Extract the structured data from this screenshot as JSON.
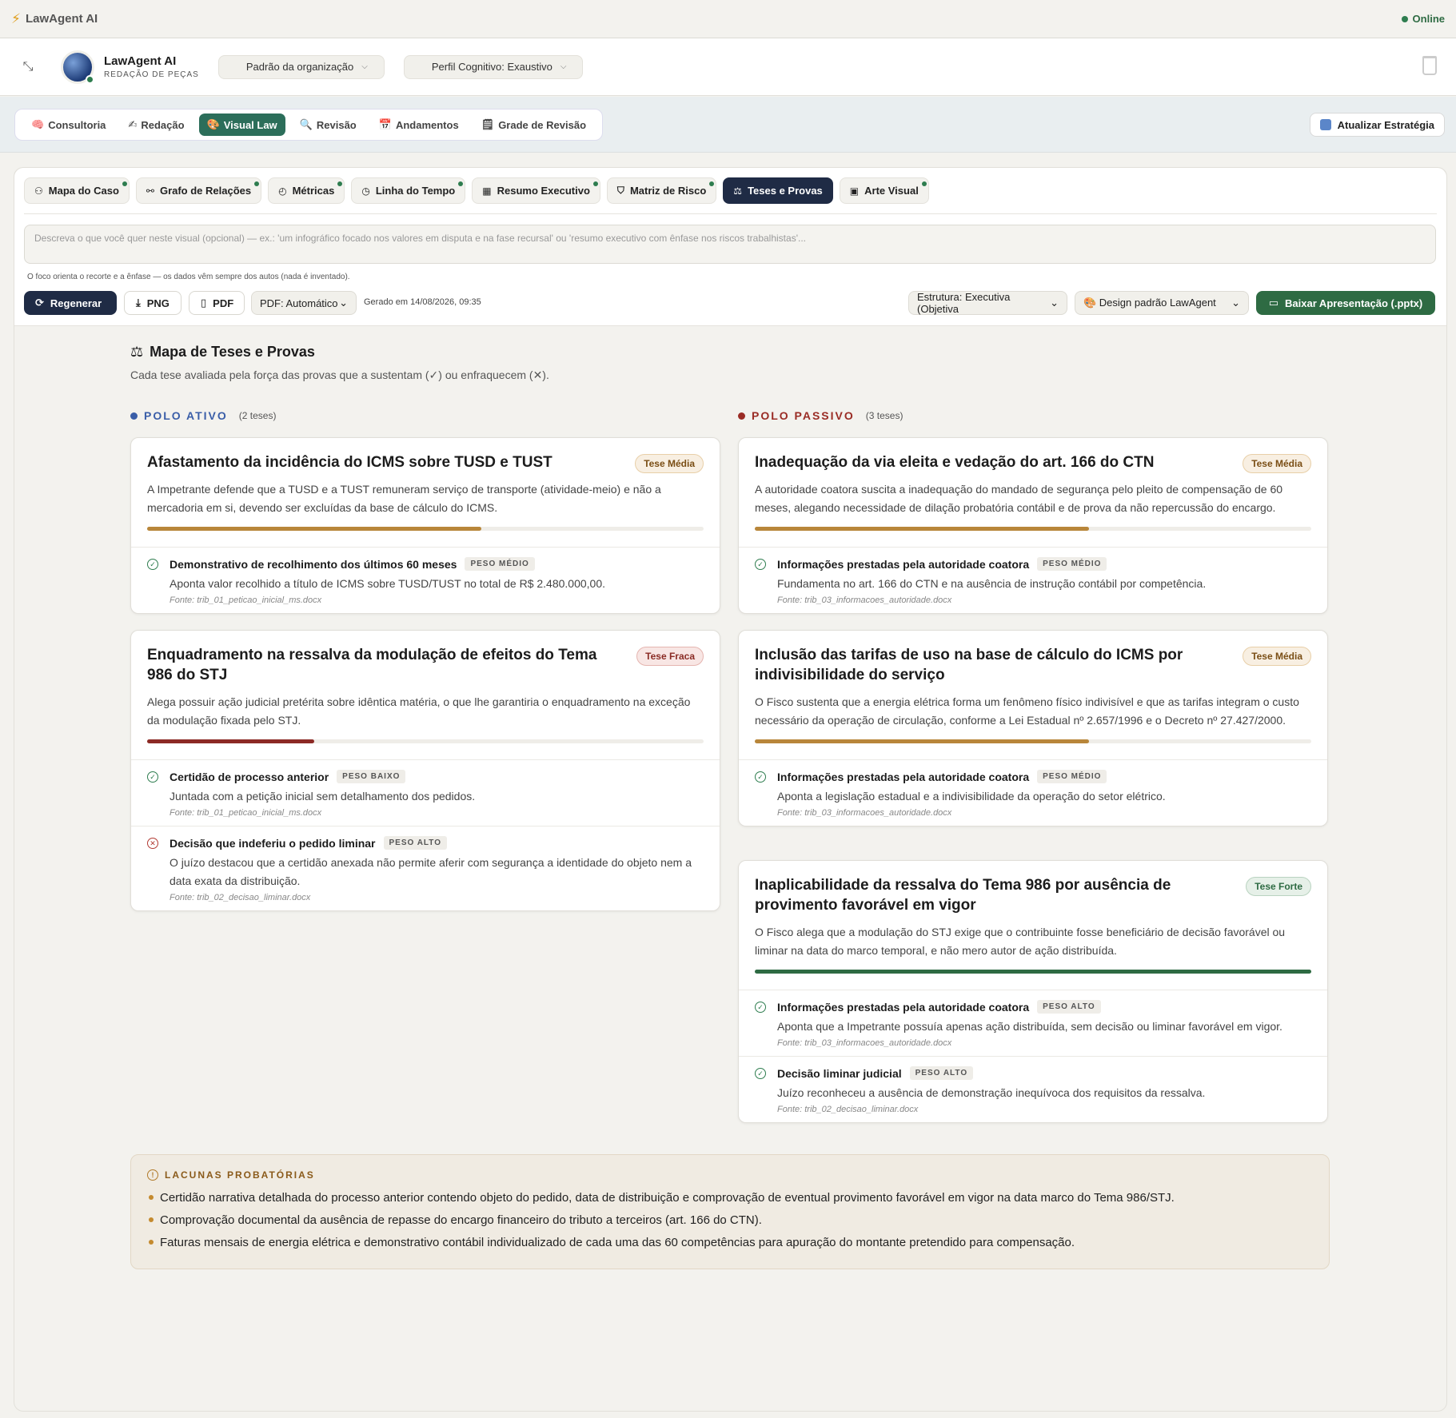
{
  "topbar": {
    "brand": "LawAgent AI",
    "status": "Online"
  },
  "header": {
    "app_name": "LawAgent AI",
    "app_subtitle": "REDAÇÃO DE PEÇAS",
    "org_select": "Padrão da organização",
    "profile_select": "Perfil Cognitivo: Exaustivo"
  },
  "main_tabs": [
    {
      "icon": "🧠",
      "label": "Consultoria"
    },
    {
      "icon": "✍",
      "label": "Redação"
    },
    {
      "icon": "🎨",
      "label": "Visual Law"
    },
    {
      "icon": "🔍",
      "label": "Revisão"
    },
    {
      "icon": "📅",
      "label": "Andamentos"
    },
    {
      "icon": "🗒",
      "label": "Grade de Revisão"
    }
  ],
  "refresh_label": "Atualizar Estratégia",
  "sub_tabs": [
    {
      "icon": "⚇",
      "label": "Mapa do Caso"
    },
    {
      "icon": "⚯",
      "label": "Grafo de Relações"
    },
    {
      "icon": "◴",
      "label": "Métricas"
    },
    {
      "icon": "◷",
      "label": "Linha do Tempo"
    },
    {
      "icon": "▦",
      "label": "Resumo Executivo"
    },
    {
      "icon": "⛉",
      "label": "Matriz de Risco"
    },
    {
      "icon": "⚖",
      "label": "Teses e Provas"
    },
    {
      "icon": "▣",
      "label": "Arte Visual"
    }
  ],
  "prompt_placeholder": "Descreva o que você quer neste visual (opcional) — ex.: 'um infográfico focado nos valores em disputa e na fase recursal' ou 'resumo executivo com ênfase nos riscos trabalhistas'...",
  "hint": "O foco orienta o recorte e a ênfase — os dados vêm sempre dos autos (nada é inventado).",
  "actions": {
    "regenerate": "Regenerar",
    "png": "PNG",
    "pdf": "PDF",
    "pdf_mode": "PDF: Automático",
    "generated": "Gerado em 14/08/2026, 09:35",
    "structure": "Estrutura: Executiva (Objetiva",
    "design": "🎨 Design padrão LawAgent",
    "download": "Baixar Apresentação (.pptx)"
  },
  "map": {
    "title": "Mapa de Teses e Provas",
    "subtitle": "Cada tese avaliada pela força das provas que a sustentam (✓) ou enfraquecem (✕)."
  },
  "active": {
    "label": "POLO ATIVO",
    "count": "(2 teses)",
    "color": "#3a5ea8",
    "cards": [
      {
        "title": "Afastamento da incidência do ICMS sobre TUSD e TUST",
        "badge": "Tese Média",
        "desc": "A Impetrante defende que a TUSD e a TUST remuneram serviço de transporte (atividade-meio) e não a mercadoria em si, devendo ser excluídas da base de cálculo do ICMS.",
        "strength": 0.6,
        "evidence": [
          {
            "title": "Demonstrativo de recolhimento dos últimos 60 meses",
            "weight": "PESO MÉDIO",
            "desc": "Aponta valor recolhido a título de ICMS sobre TUSD/TUST no total de R$ 2.480.000,00.",
            "source": "Fonte: trib_01_peticao_inicial_ms.docx"
          }
        ]
      },
      {
        "title": "Enquadramento na ressalva da modulação de efeitos do Tema 986 do STJ",
        "badge": "Tese Fraca",
        "desc": "Alega possuir ação judicial pretérita sobre idêntica matéria, o que lhe garantiria o enquadramento na exceção da modulação fixada pelo STJ.",
        "strength": 0.3,
        "evidence": [
          {
            "title": "Certidão de processo anterior",
            "weight": "PESO BAIXO",
            "desc": "Juntada com a petição inicial sem detalhamento dos pedidos.",
            "source": "Fonte: trib_01_peticao_inicial_ms.docx"
          },
          {
            "title": "Decisão que indeferiu o pedido liminar",
            "weight": "PESO ALTO",
            "desc": "O juízo destacou que a certidão anexada não permite aferir com segurança a identidade do objeto nem a data exata da distribuição.",
            "source": "Fonte: trib_02_decisao_liminar.docx"
          }
        ]
      }
    ]
  },
  "passive": {
    "label": "POLO PASSIVO",
    "count": "(3 teses)",
    "color": "#9a2c25",
    "cards": [
      {
        "title": "Inadequação da via eleita e vedação do art. 166 do CTN",
        "badge": "Tese Média",
        "desc": "A autoridade coatora suscita a inadequação do mandado de segurança pelo pleito de compensação de 60 meses, alegando necessidade de dilação probatória contábil e de prova da não repercussão do encargo.",
        "strength": 0.6,
        "evidence": [
          {
            "title": "Informações prestadas pela autoridade coatora",
            "weight": "PESO MÉDIO",
            "desc": "Fundamenta no art. 166 do CTN e na ausência de instrução contábil por competência.",
            "source": "Fonte: trib_03_informacoes_autoridade.docx"
          }
        ]
      },
      {
        "title": "Inclusão das tarifas de uso na base de cálculo do ICMS por indivisibilidade do serviço",
        "badge": "Tese Média",
        "desc": "O Fisco sustenta que a energia elétrica forma um fenômeno físico indivisível e que as tarifas integram o custo necessário da operação de circulação, conforme a Lei Estadual nº 2.657/1996 e o Decreto nº 27.427/2000.",
        "strength": 0.6,
        "evidence": [
          {
            "title": "Informações prestadas pela autoridade coatora",
            "weight": "PESO MÉDIO",
            "desc": "Aponta a legislação estadual e a indivisibilidade da operação do setor elétrico.",
            "source": "Fonte: trib_03_informacoes_autoridade.docx"
          }
        ]
      },
      {
        "title": "Inaplicabilidade da ressalva do Tema 986 por ausência de provimento favorável em vigor",
        "badge": "Tese Forte",
        "desc": "O Fisco alega que a modulação do STJ exige que o contribuinte fosse beneficiário de decisão favorável ou liminar na data do marco temporal, e não mero autor de ação distribuída.",
        "strength": 1.0,
        "evidence": [
          {
            "title": "Informações prestadas pela autoridade coatora",
            "weight": "PESO ALTO",
            "desc": "Aponta que a Impetrante possuía apenas ação distribuída, sem decisão ou liminar favorável em vigor.",
            "source": "Fonte: trib_03_informacoes_autoridade.docx"
          },
          {
            "title": "Decisão liminar judicial",
            "weight": "PESO ALTO",
            "desc": "Juízo reconheceu a ausência de demonstração inequívoca dos requisitos da ressalva.",
            "source": "Fonte: trib_02_decisao_liminar.docx"
          }
        ]
      }
    ]
  },
  "gaps": {
    "title": "LACUNAS PROBATÓRIAS",
    "items": [
      "Certidão narrativa detalhada do processo anterior contendo objeto do pedido, data de distribuição e comprovação de eventual provimento favorável em vigor na data marco do Tema 986/STJ.",
      "Comprovação documental da ausência de repasse do encargo financeiro do tributo a terceiros (art. 166 do CTN).",
      "Faturas mensais de energia elétrica e demonstrativo contábil individualizado de cada uma das 60 competências para apuração do montante pretendido para compensação."
    ]
  },
  "colors": {
    "medium": "#b8863a",
    "weak": "#8c2a25",
    "strong": "#2e6b43",
    "accent": "#2c6e5a",
    "navy": "#1f2b45"
  }
}
